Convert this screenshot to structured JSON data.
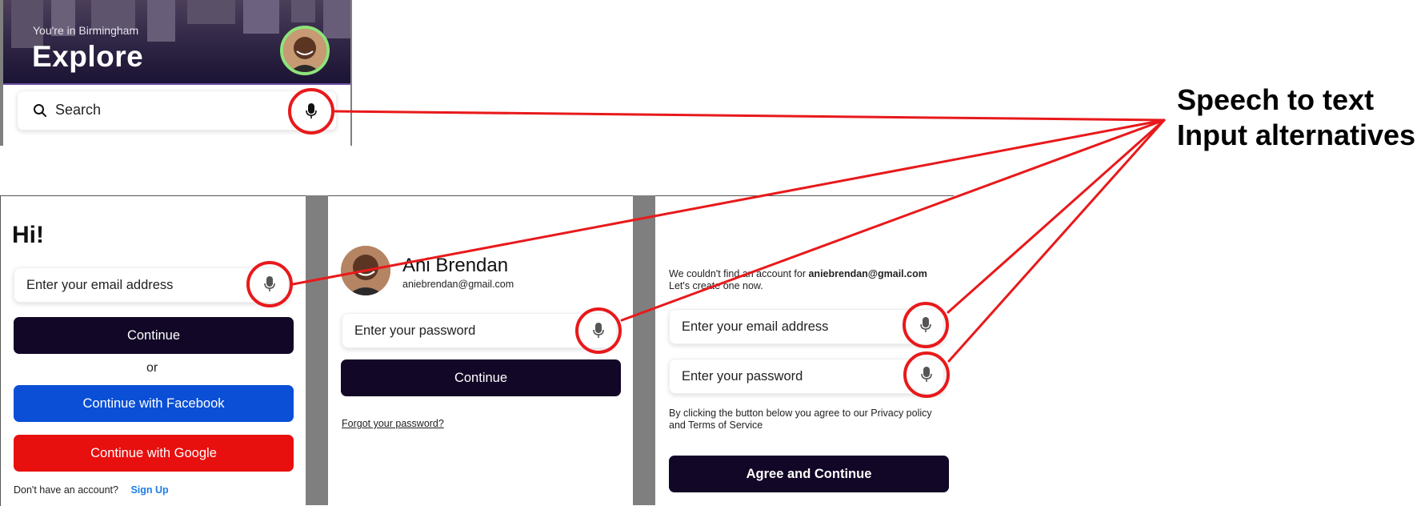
{
  "explore": {
    "location": "You're in Birmingham",
    "title": "Explore",
    "search_placeholder": "Search"
  },
  "login": {
    "greeting": "Hi!",
    "email_placeholder": "Enter your email address",
    "continue_label": "Continue",
    "or_label": "or",
    "facebook_label": "Continue with Facebook",
    "google_label": "Continue with Google",
    "no_account_text": "Don't have an account?",
    "signup_label": "Sign Up"
  },
  "password": {
    "user_name": "Ani Brendan",
    "user_email": "aniebrendan@gmail.com",
    "password_placeholder": "Enter your password",
    "continue_label": "Continue",
    "forgot_label": "Forgot your password?"
  },
  "signup": {
    "notice_prefix": "We couldn't find an account for ",
    "notice_email": "aniebrendan@gmail.com",
    "notice_line2": "Let's create one now.",
    "email_placeholder": "Enter your email address",
    "password_placeholder": "Enter your password",
    "terms_line1": "By clicking the button below you agree to our Privacy policy",
    "terms_line2": "and Terms of Service",
    "agree_label": "Agree and Continue"
  },
  "annotation": {
    "line1": "Speech to text",
    "line2": "Input alternatives"
  },
  "colors": {
    "highlight_red": "#e8191b",
    "button_dark": "#120726",
    "facebook_blue": "#0a4fd6",
    "google_red": "#e80f0f",
    "avatar_ring_green": "#8ee37a"
  }
}
